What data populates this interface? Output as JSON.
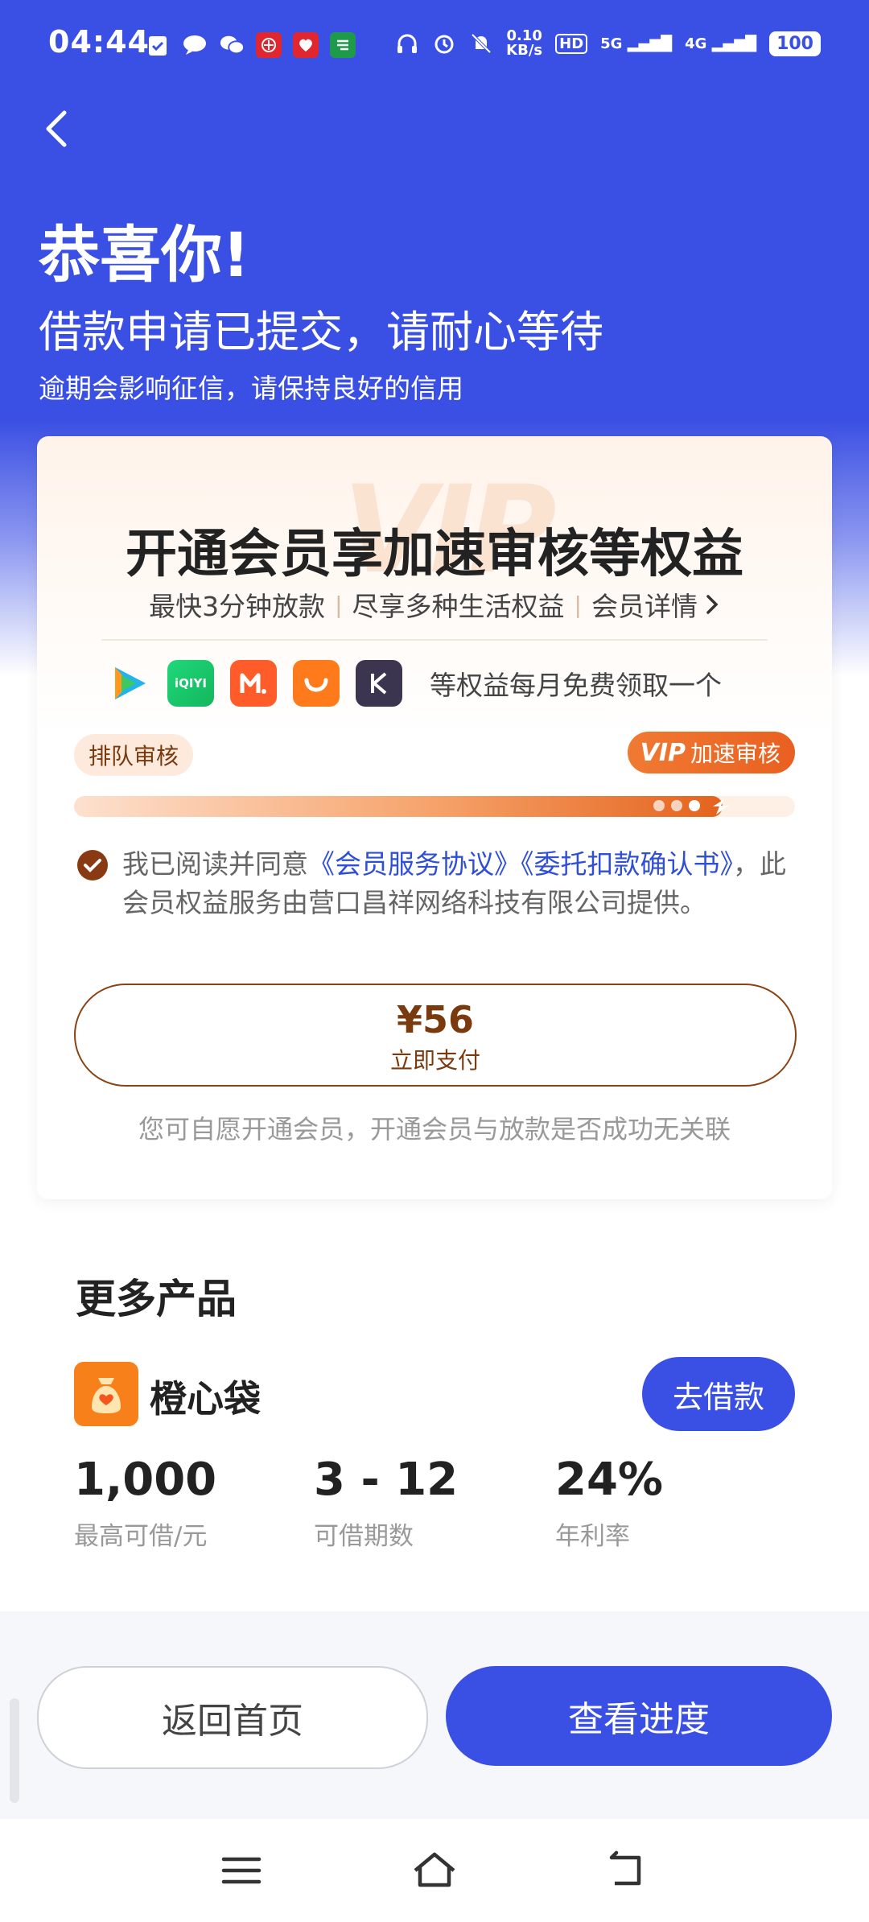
{
  "status_bar": {
    "time": "04:44",
    "net_speed_value": "0.10",
    "net_speed_unit": "KB/s",
    "hd": "HD",
    "signal_1": "5G",
    "signal_2": "4G",
    "battery": "100"
  },
  "header": {
    "title": "恭喜你!",
    "subtitle": "借款申请已提交，请耐心等待",
    "note": "逾期会影响征信，请保持良好的信用"
  },
  "member_card": {
    "watermark": "VIP",
    "title": "开通会员享加速审核等权益",
    "features": [
      "最快3分钟放款",
      "尽享多种生活权益"
    ],
    "detail_link": "会员详情",
    "logos": [
      "tencent-video-logo",
      "iqiyi-logo",
      "mango-tv-logo",
      "didi-logo",
      "k-logo"
    ],
    "iqiyi_text": "iQIYI",
    "logos_caption": "等权益每月免费领取一个",
    "queue_label": "排队审核",
    "vip_logo": "VIP",
    "vip_label": "加速审核",
    "progress_fraction": 0.9,
    "agreement_prefix": "我已阅读并同意",
    "agreement_link_1": "《会员服务协议》",
    "agreement_link_2": "《委托扣款确认书》",
    "agreement_suffix": "，此会员权益服务由营口昌祥网络科技有限公司提供。",
    "pay_amount": "¥56",
    "pay_label": "立即支付",
    "disclaimer": "您可自愿开通会员，开通会员与放款是否成功无关联"
  },
  "more_products": {
    "title": "更多产品",
    "product": {
      "name": "橙心袋",
      "borrow_label": "去借款",
      "stats": [
        {
          "value": "1,000",
          "label": "最高可借/元"
        },
        {
          "value": "3 - 12",
          "label": "可借期数"
        },
        {
          "value": "24%",
          "label": "年利率"
        }
      ]
    }
  },
  "actions": {
    "home_label": "返回首页",
    "progress_label": "查看进度"
  },
  "colors": {
    "primary": "#3a4fe3",
    "accent_orange": "#e96021",
    "brown": "#7a3a0e"
  }
}
